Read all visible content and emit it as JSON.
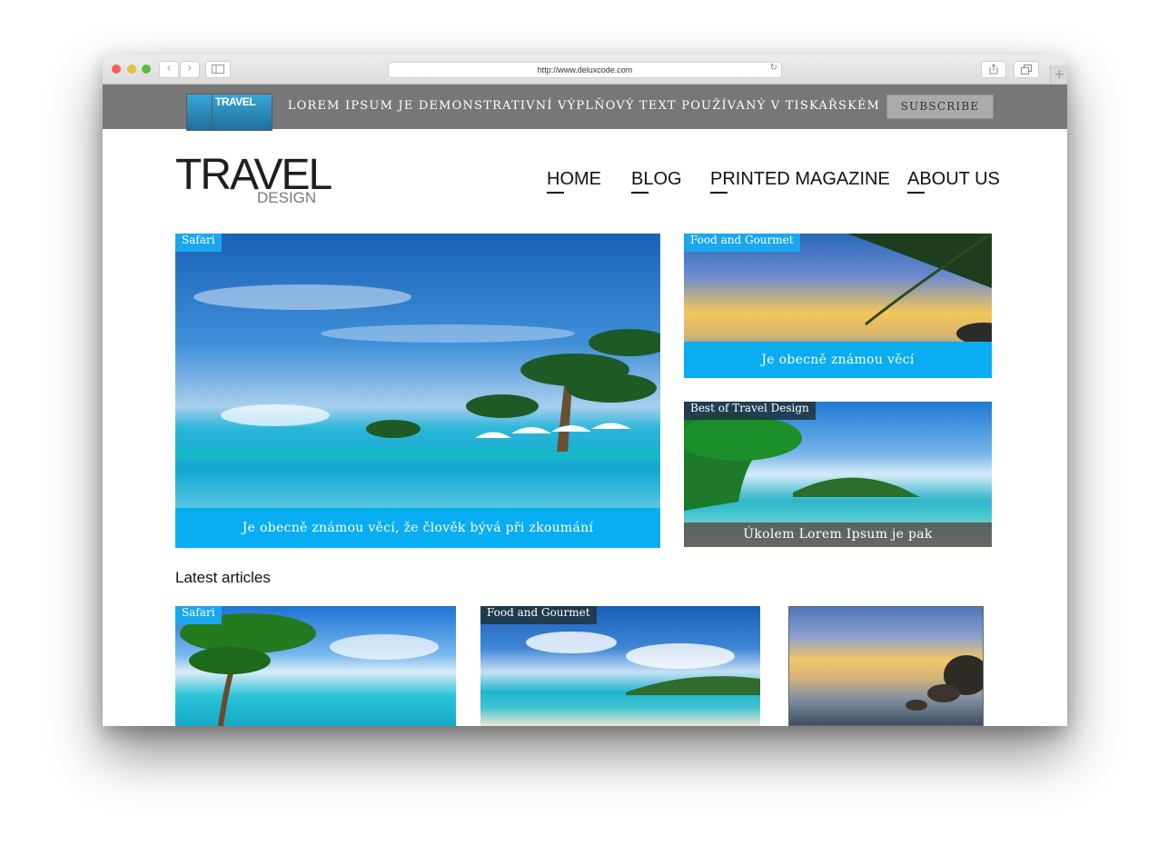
{
  "browser": {
    "url": "http://www.deluxcode.com",
    "back_icon": "chevron-left-icon",
    "forward_icon": "chevron-right-icon",
    "sidebar_icon": "sidebar-icon",
    "reload_icon": "reload-icon",
    "share_icon": "share-icon",
    "tabs_icon": "tabs-icon",
    "new_tab_icon": "plus-icon"
  },
  "topbar": {
    "magazine_title": "TRAVEL",
    "text": "LOREM IPSUM JE DEMONSTRATIVNÍ VÝPLŇOVÝ TEXT POUŽÍVANÝ V TISKAŘSKÉM",
    "subscribe_label": "SUBSCRIBE"
  },
  "header": {
    "logo_main": "TRAVEL",
    "logo_sub": "DESIGN",
    "nav": [
      "HOME",
      "BLOG",
      "PRINTED MAGAZINE",
      "ABOUT US"
    ]
  },
  "featured": {
    "main": {
      "tag": "Safari",
      "caption": "Je obecně známou věcí, že člověk bývá při zkoumání"
    },
    "side_top": {
      "tag": "Food and Gourmet",
      "caption": "Je obecně známou věcí"
    },
    "side_bottom": {
      "tag": "Best of Travel Design",
      "caption": "Úkolem Lorem Ipsum je pak"
    }
  },
  "latest": {
    "title": "Latest articles",
    "cards": [
      {
        "tag": "Safari"
      },
      {
        "tag": "Food and Gourmet"
      },
      {
        "tag": ""
      }
    ]
  },
  "colors": {
    "accent": "#09adf2",
    "topbar": "#777777"
  }
}
